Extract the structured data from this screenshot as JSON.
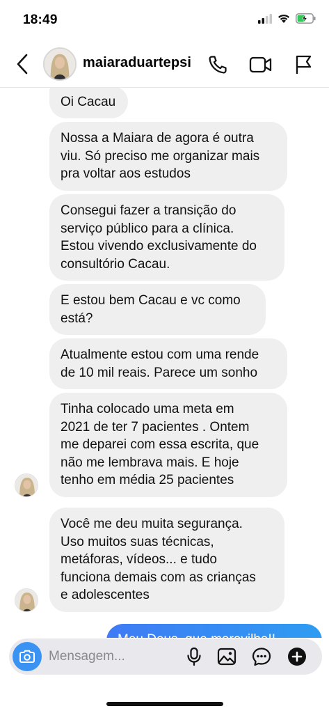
{
  "status_bar": {
    "time": "18:49",
    "signal_icon": "cellular-signal-icon",
    "wifi_icon": "wifi-icon",
    "battery_icon": "battery-charging-icon",
    "battery_color": "#34c759"
  },
  "header": {
    "username": "maiaraduartepsi",
    "back_icon": "chevron-left-icon",
    "call_icon": "phone-icon",
    "video_icon": "video-camera-icon",
    "flag_icon": "flag-icon"
  },
  "messages": [
    {
      "text": "Oi Cacau"
    },
    {
      "text": "Nossa a Maiara de agora é outra\nviu. Só preciso me organizar mais\npra voltar aos estudos"
    },
    {
      "text": "Consegui fazer a transição do\nserviço público para a clínica.\nEstou vivendo exclusivamente do\nconsultório Cacau."
    },
    {
      "text": "E estou bem Cacau e vc como\nestá?"
    },
    {
      "text": "Atualmente estou com uma rende\nde 10 mil reais. Parece um sonho"
    },
    {
      "text": "Tinha colocado uma meta em\n2021 de ter 7 pacientes . Ontem\nme deparei com essa escrita, que\nnão me lembrava mais. E hoje\ntenho em média 25 pacientes"
    },
    {
      "text": "Você me deu muita segurança.\nUso muitos suas técnicas,\nmetáforas, vídeos... e tudo\nfunciona demais com as crianças\ne adolescentes"
    }
  ],
  "sent_message": {
    "text": "Meu Deus, que maravilha!!"
  },
  "composer": {
    "placeholder": "Mensagem...",
    "camera_icon": "camera-icon",
    "mic_icon": "microphone-icon",
    "gallery_icon": "image-icon",
    "sticker_icon": "sticker-chat-icon",
    "add_icon": "plus-circle-icon",
    "accent_color": "#3a92f3"
  }
}
